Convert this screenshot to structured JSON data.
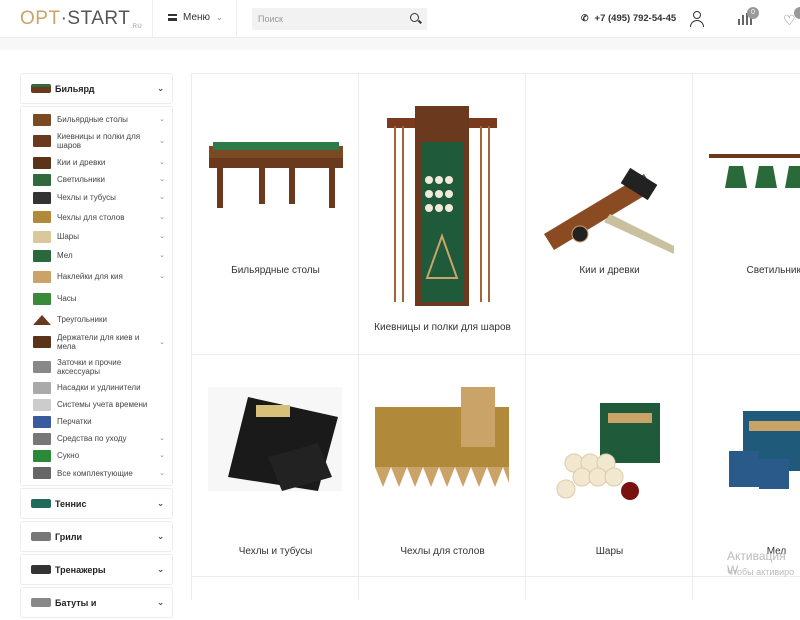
{
  "header": {
    "logo_part1": "OPT",
    "logo_sep": "·",
    "logo_part2": "START",
    "logo_suffix": ".RU",
    "menu_label": "Меню",
    "search_placeholder": "Поиск",
    "phone": "+7 (495) 792-54-45",
    "compare_count": "0"
  },
  "sidebar": {
    "top_category": "Бильярд",
    "subcategories": [
      {
        "label": "Бильярдные столы",
        "has_children": true,
        "icon": "pool-table-thumb"
      },
      {
        "label": "Киевницы и полки для шаров",
        "has_children": true,
        "icon": "cue-rack-thumb"
      },
      {
        "label": "Кии и древки",
        "has_children": true,
        "icon": "cue-thumb"
      },
      {
        "label": "Светильники",
        "has_children": true,
        "icon": "lamp-thumb"
      },
      {
        "label": "Чехлы и тубусы",
        "has_children": true,
        "icon": "case-thumb"
      },
      {
        "label": "Чехлы для столов",
        "has_children": true,
        "icon": "table-cover-thumb"
      },
      {
        "label": "Шары",
        "has_children": true,
        "icon": "balls-thumb"
      },
      {
        "label": "Мел",
        "has_children": true,
        "icon": "chalk-thumb"
      },
      {
        "label": "Наклейки для кия",
        "has_children": true,
        "icon": "tips-thumb"
      },
      {
        "label": "Часы",
        "has_children": false,
        "icon": "clock-thumb"
      },
      {
        "label": "Треугольники",
        "has_children": false,
        "icon": "triangle-thumb"
      },
      {
        "label": "Держатели для киев и мела",
        "has_children": true,
        "icon": "holder-thumb"
      },
      {
        "label": "Заточки и прочие аксессуары",
        "has_children": false,
        "icon": "sharpener-thumb"
      },
      {
        "label": "Насадки и удлинители",
        "has_children": false,
        "icon": "extension-thumb"
      },
      {
        "label": "Системы учета времени",
        "has_children": false,
        "icon": "timer-thumb"
      },
      {
        "label": "Перчатки",
        "has_children": false,
        "icon": "gloves-thumb"
      },
      {
        "label": "Средства по уходу",
        "has_children": true,
        "icon": "care-thumb"
      },
      {
        "label": "Сукно",
        "has_children": true,
        "icon": "cloth-thumb"
      },
      {
        "label": "Все комплектующие",
        "has_children": true,
        "icon": "parts-thumb"
      }
    ],
    "other_categories": [
      {
        "label": "Теннис",
        "icon": "tennis-table-thumb"
      },
      {
        "label": "Грили",
        "icon": "grill-thumb"
      },
      {
        "label": "Тренажеры",
        "icon": "trainer-thumb"
      },
      {
        "label": "Батуты и",
        "icon": "trampoline-thumb"
      }
    ]
  },
  "products": [
    {
      "label": "Бильярдные столы"
    },
    {
      "label": "Киевницы и полки для шаров"
    },
    {
      "label": "Кии и древки"
    },
    {
      "label": "Светильники"
    },
    {
      "label": "Чехлы и тубусы"
    },
    {
      "label": "Чехлы для столов"
    },
    {
      "label": "Шары"
    },
    {
      "label": "Мел"
    }
  ],
  "watermark": {
    "line1": "Активация W",
    "line2": "Чтобы активиро"
  },
  "colors": {
    "brand_gold": "#c9a368",
    "border": "#ececec"
  }
}
